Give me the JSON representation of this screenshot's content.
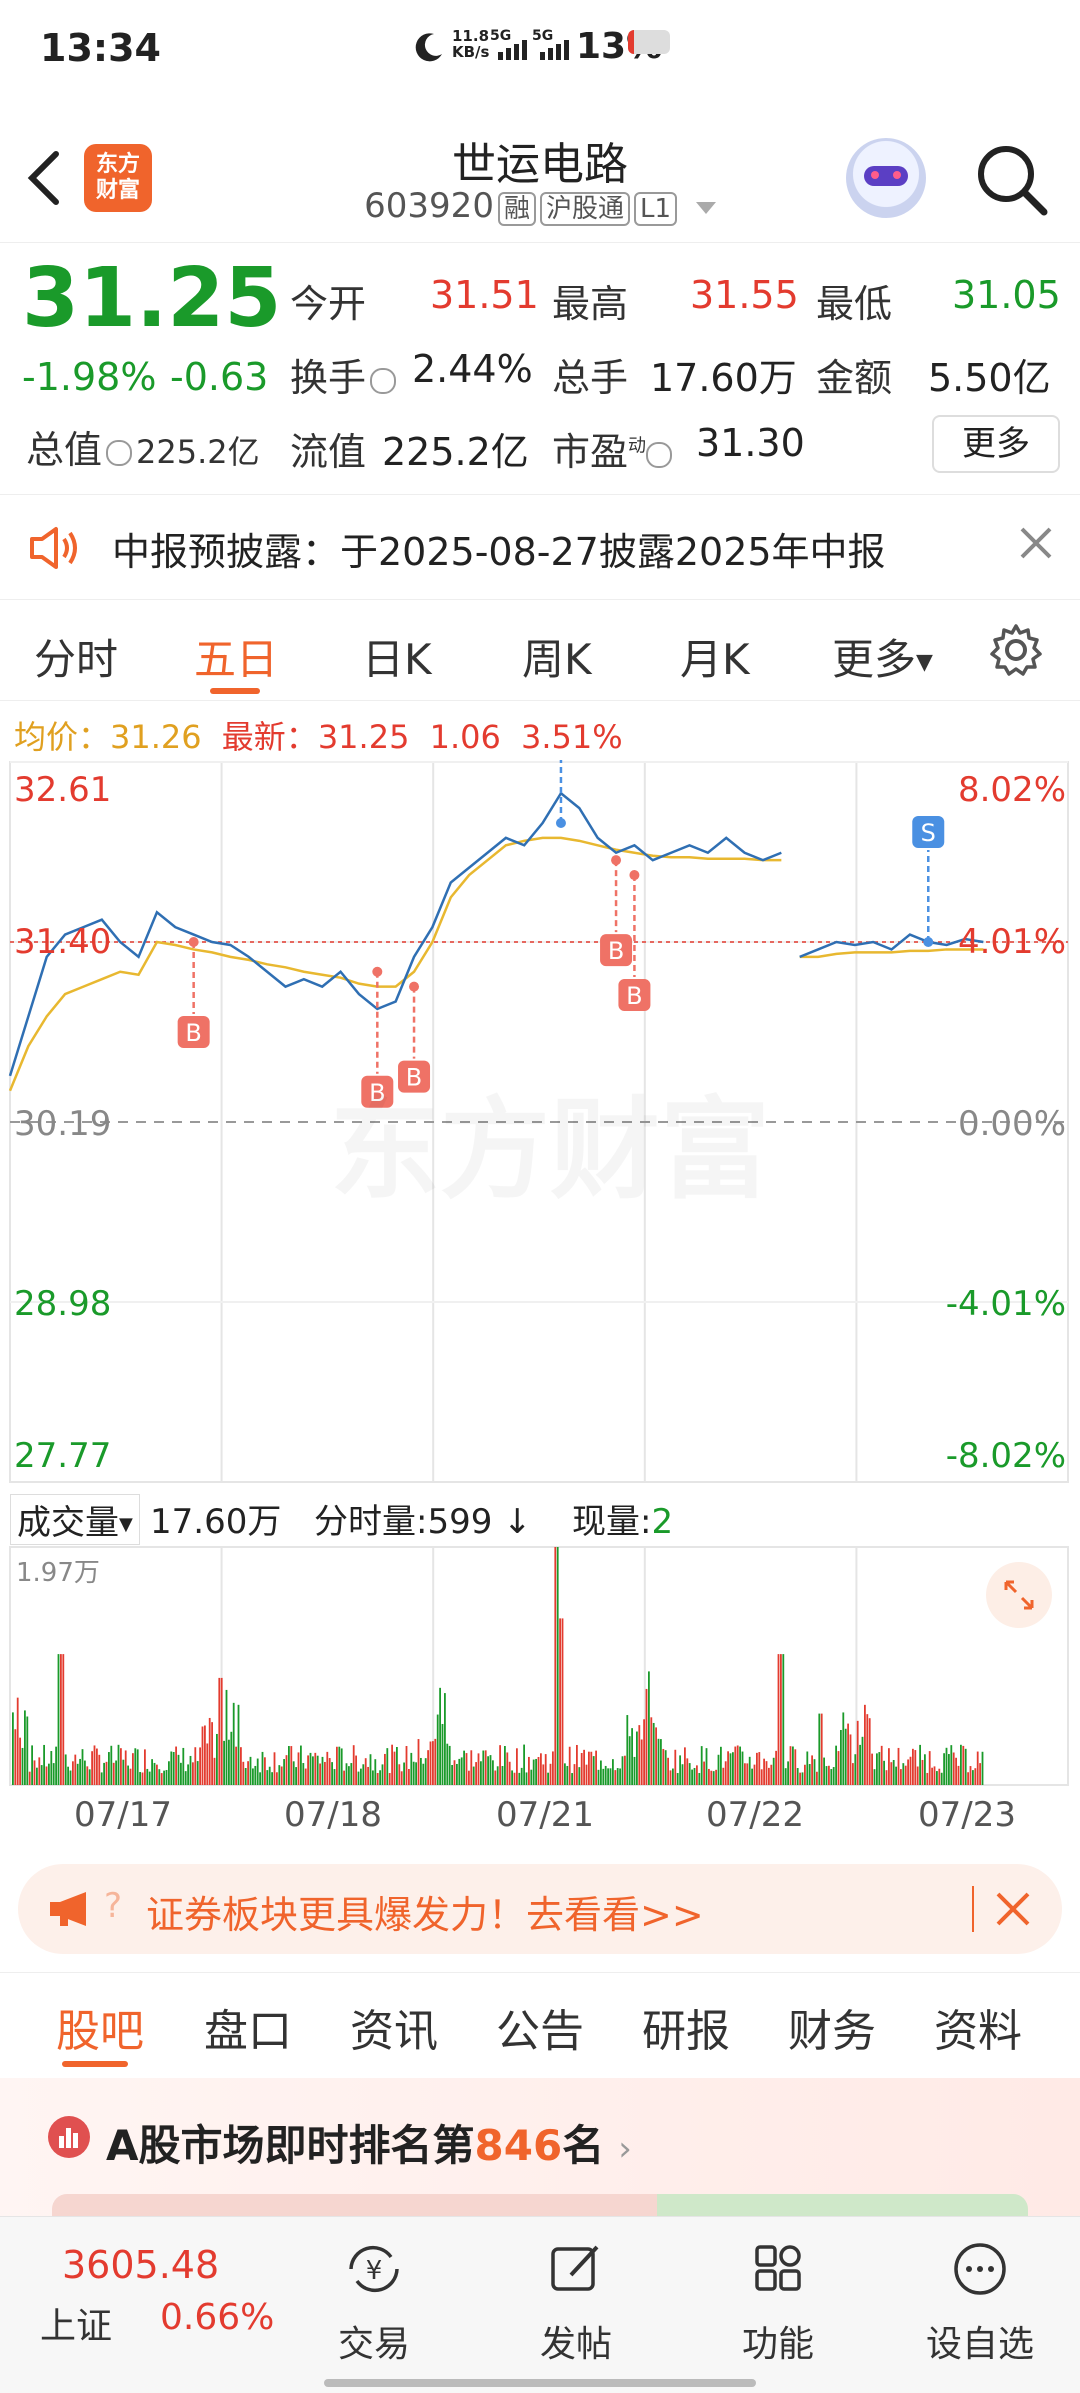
{
  "status": {
    "time": "13:34",
    "net_speed": "11.8",
    "net_unit": "KB/s",
    "sig1": "5G",
    "sig2": "5G",
    "battery": "13%"
  },
  "header": {
    "title": "世运电路",
    "code": "603920",
    "tags": [
      "融",
      "沪股通",
      "L1"
    ],
    "logo_text_1": "东方",
    "logo_text_2": "财富"
  },
  "quote": {
    "price": "31.25",
    "change_pct": "-1.98%",
    "change": "-0.63",
    "open_label": "今开",
    "open": "31.51",
    "high_label": "最高",
    "high": "31.55",
    "low_label": "最低",
    "low": "31.05",
    "turnover_label": "换手",
    "turnover": "2.44%",
    "volume_label": "总手",
    "volume": "17.60万",
    "amount_label": "金额",
    "amount": "5.50亿",
    "mktcap_label": "总值",
    "mktcap": "225.2亿",
    "float_label": "流值",
    "float": "225.2亿",
    "pe_label": "市盈",
    "pe_sup": "动",
    "pe": "31.30",
    "more": "更多"
  },
  "notice": {
    "text": "中报预披露：于2025-08-27披露2025年中报"
  },
  "period_tabs": [
    "分时",
    "五日",
    "日K",
    "周K",
    "月K",
    "更多"
  ],
  "active_tab": 1,
  "chart_info": {
    "avg_label": "均价：",
    "avg": "31.26",
    "latest_label": "最新：",
    "latest": "31.25",
    "chg": "1.06",
    "chg_pct": "3.51%"
  },
  "chart_data": {
    "type": "line",
    "x": [
      "07/17",
      "07/18",
      "07/21",
      "07/22",
      "07/23"
    ],
    "ylim": [
      27.77,
      32.61
    ],
    "y_ticks_left": [
      "32.61",
      "31.40",
      "30.19",
      "28.98",
      "27.77"
    ],
    "y_ticks_right": [
      "8.02%",
      "4.01%",
      "0.00%",
      "-4.01%",
      "-8.02%"
    ],
    "base": 30.19,
    "series": [
      {
        "values": [
          30.5,
          30.9,
          31.3,
          31.45,
          31.5,
          31.55,
          31.4,
          31.3,
          31.6,
          31.5,
          31.45,
          31.4,
          31.38,
          31.3,
          31.2,
          31.1,
          31.15,
          31.1,
          31.2,
          31.05,
          30.95,
          31.0,
          31.3,
          31.5,
          31.8,
          31.9,
          32.0,
          32.1,
          32.05,
          32.2,
          32.4,
          32.3,
          32.1,
          32.0,
          32.05,
          31.95,
          32.0,
          32.05,
          32.0,
          32.1,
          32.0,
          31.95,
          32.0,
          31.3,
          31.35,
          31.4,
          31.38,
          31.4,
          31.35,
          31.45,
          31.4,
          31.38,
          31.42,
          31.4
        ]
      },
      {
        "values": [
          30.4,
          30.7,
          30.9,
          31.05,
          31.1,
          31.15,
          31.2,
          31.18,
          31.4,
          31.38,
          31.35,
          31.33,
          31.3,
          31.28,
          31.25,
          31.23,
          31.2,
          31.18,
          31.16,
          31.12,
          31.1,
          31.1,
          31.2,
          31.4,
          31.7,
          31.85,
          31.95,
          32.05,
          32.08,
          32.1,
          32.1,
          32.08,
          32.05,
          32.02,
          32.0,
          31.98,
          31.97,
          31.97,
          31.96,
          31.96,
          31.96,
          31.95,
          31.95,
          31.3,
          31.3,
          31.32,
          31.33,
          31.33,
          31.33,
          31.34,
          31.34,
          31.35,
          31.35,
          31.35
        ]
      }
    ],
    "markers": [
      {
        "type": "B",
        "x_idx": 10,
        "y": 31.4
      },
      {
        "type": "B",
        "x_idx": 20,
        "y": 31.2
      },
      {
        "type": "B",
        "x_idx": 22,
        "y": 31.1
      },
      {
        "type": "S",
        "x_idx": 30,
        "y": 32.2
      },
      {
        "type": "B",
        "x_idx": 33,
        "y": 31.95
      },
      {
        "type": "B",
        "x_idx": 34,
        "y": 31.85
      },
      {
        "type": "S",
        "x_idx": 50,
        "y": 31.4
      }
    ],
    "watermark": "东方财富"
  },
  "volume": {
    "label": "成交量",
    "total": "17.60万",
    "min_label": "分时量:",
    "min": "599",
    "cur_label": "现量:",
    "cur": "2",
    "max": "1.97万",
    "dates": [
      "07/17",
      "07/18",
      "07/21",
      "07/22",
      "07/23"
    ]
  },
  "banner": {
    "text": "证券板块更具爆发力！去看看>>"
  },
  "bottom_tabs": [
    "股吧",
    "盘口",
    "资讯",
    "公告",
    "研报",
    "财务",
    "资料"
  ],
  "ranking": {
    "prefix": "A股市场即时排名第",
    "rank": "846",
    "suffix": "名"
  },
  "bottom_nav": {
    "index_value": "3605.48",
    "index_name": "上证",
    "index_chg": "0.66%",
    "items": [
      "交易",
      "发帖",
      "功能",
      "设自选"
    ]
  }
}
